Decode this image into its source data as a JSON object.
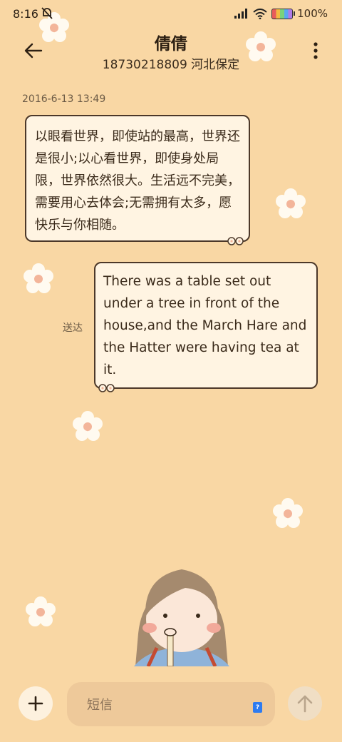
{
  "status_bar": {
    "time": "8:16",
    "battery": "100%"
  },
  "header": {
    "contact_name": "倩倩",
    "contact_detail": "18730218809 河北保定"
  },
  "messages": {
    "timestamp": "2016-6-13 13:49",
    "incoming_text": "以眼看世界，即使站的最高，世界还是很小;以心看世界，即使身处局限，世界依然很大。生活远不完美，需要用心去体会;无需拥有太多，愿快乐与你相随。",
    "outgoing_text": "There was a table set out under a tree in front of the house,and the March Hare and the Hatter were having tea at it.",
    "outgoing_status": "送达"
  },
  "composer": {
    "placeholder": "短信",
    "sim_badge": "?"
  },
  "icons": [
    "mute-icon",
    "signal-icon",
    "wifi-icon",
    "battery-icon",
    "back-arrow-icon",
    "more-vert-icon",
    "plus-icon",
    "sim-card-icon",
    "send-arrow-icon",
    "flower-icon"
  ],
  "colors": {
    "background": "#f9d7a4",
    "bubble": "#fff4e2",
    "bubble_border": "#4c3829",
    "input": "#eec99a",
    "sim_blue": "#2e7bf0"
  }
}
